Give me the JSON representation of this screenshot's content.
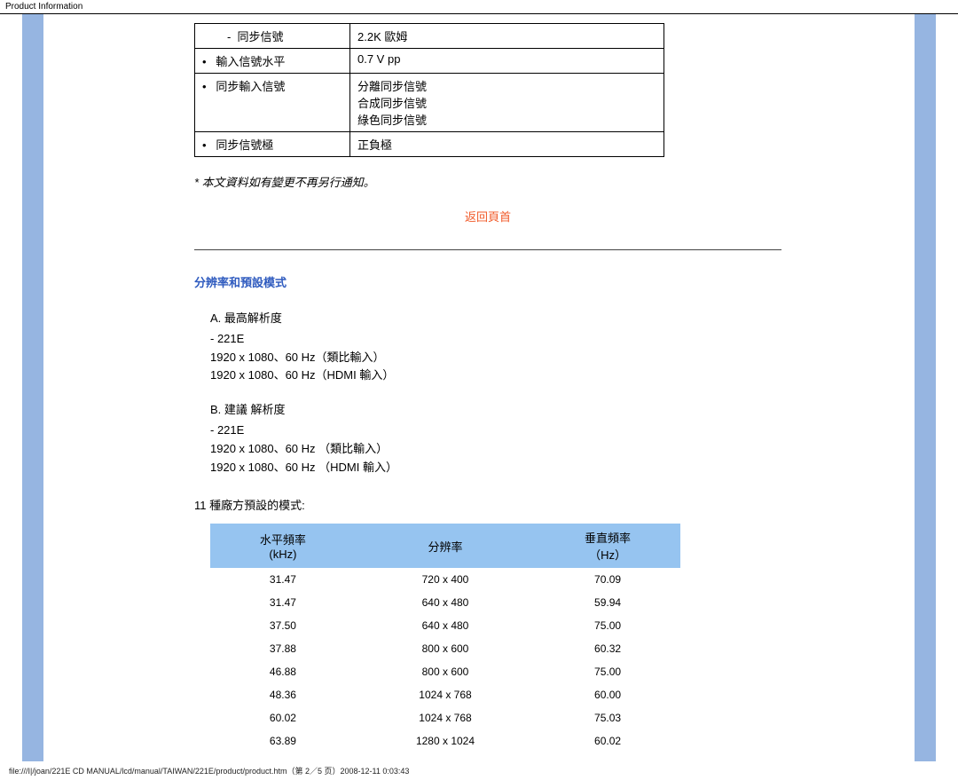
{
  "header": {
    "title": "Product Information"
  },
  "spec_rows": [
    {
      "label_prefix": "-",
      "label": "同步信號",
      "value_lines": [
        "2.2K 歐姆"
      ],
      "indent": true
    },
    {
      "label_prefix": "•",
      "label": "輸入信號水平",
      "value_lines": [
        "0.7 V pp"
      ],
      "indent": false
    },
    {
      "label_prefix": "•",
      "label": "同步輸入信號",
      "value_lines": [
        "分離同步信號",
        "合成同步信號",
        "綠色同步信號"
      ],
      "indent": false
    },
    {
      "label_prefix": "•",
      "label": "同步信號極",
      "value_lines": [
        "正負極"
      ],
      "indent": false
    }
  ],
  "notice": "* 本文資料如有變更不再另行通知。",
  "back_link": "返回頁首",
  "section_heading": "分辨率和預設模式",
  "res_sections": [
    {
      "label": "A.  最高解析度",
      "sub_prefix": "-  221E",
      "lines": [
        "1920 x 1080、60 Hz（類比輸入）",
        "1920 x 1080、60 Hz（HDMI 輸入）"
      ]
    },
    {
      "label": "B.  建議 解析度",
      "sub_prefix": "-  221E",
      "lines": [
        "1920 x 1080、60 Hz （類比輸入）",
        "1920 x 1080、60 Hz （HDMI 輸入）"
      ]
    }
  ],
  "modes_title": "11 種廠方預設的模式:",
  "modes_headers": {
    "h1_line1": "水平頻率",
    "h1_line2": "(kHz)",
    "h2": "分辨率",
    "h3_line1": "垂直頻率",
    "h3_line2": "（Hz）"
  },
  "modes_rows": [
    {
      "hfreq": "31.47",
      "res": "720 x 400",
      "vfreq": "70.09"
    },
    {
      "hfreq": "31.47",
      "res": "640 x 480",
      "vfreq": "59.94"
    },
    {
      "hfreq": "37.50",
      "res": "640 x 480",
      "vfreq": "75.00"
    },
    {
      "hfreq": "37.88",
      "res": "800 x 600",
      "vfreq": "60.32"
    },
    {
      "hfreq": "46.88",
      "res": "800 x 600",
      "vfreq": "75.00"
    },
    {
      "hfreq": "48.36",
      "res": "1024 x 768",
      "vfreq": "60.00"
    },
    {
      "hfreq": "60.02",
      "res": "1024 x 768",
      "vfreq": "75.03"
    },
    {
      "hfreq": "63.89",
      "res": "1280 x 1024",
      "vfreq": "60.02"
    }
  ],
  "footer": "file:///I|/joan/221E CD MANUAL/lcd/manual/TAIWAN/221E/product/product.htm（第 2／5 页）2008-12-11 0:03:43"
}
